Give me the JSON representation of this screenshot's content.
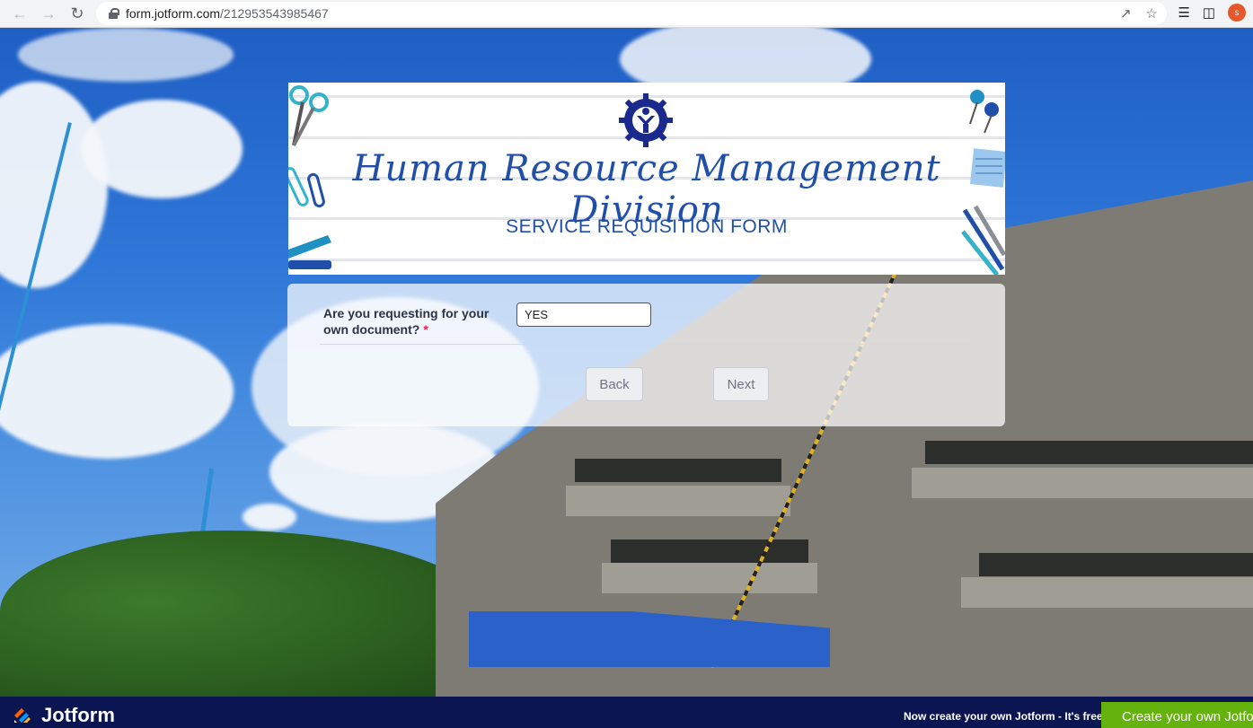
{
  "browser": {
    "url_host": "form.jotform.com",
    "url_path": "/212953543985467",
    "avatar_initial": "s"
  },
  "header": {
    "script_title": "Human Resource Management Division",
    "subtitle": "SERVICE REQUISITION FORM"
  },
  "form": {
    "question_label": "Are you requesting for your own document?",
    "required_mark": "*",
    "answer_value": "YES",
    "back_label": "Back",
    "next_label": "Next"
  },
  "footer": {
    "brand": "Jotform",
    "promo_text": "Now create your own Jotform - It's free!",
    "cta_label": "Create your own Jotform"
  },
  "colors": {
    "brand_blue": "#1f4fa8",
    "jotform_navy": "#0a1551",
    "cta_green": "#64b20d",
    "required_red": "#e8264a"
  }
}
